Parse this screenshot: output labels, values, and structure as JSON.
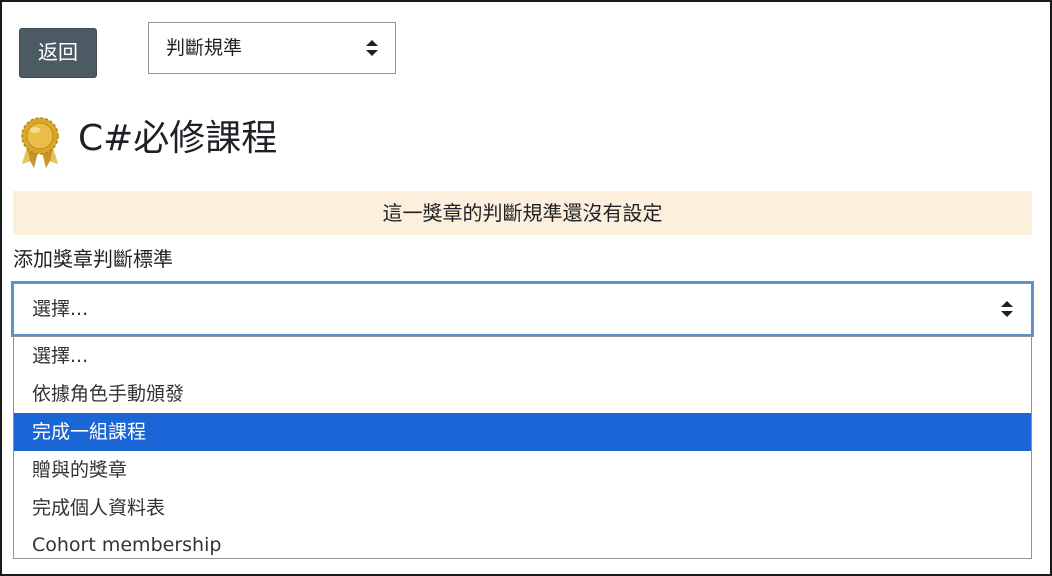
{
  "toolbar": {
    "back_label": "返回",
    "criteria_select_value": "判斷規準"
  },
  "badge": {
    "icon": "medal-icon",
    "title": "C#必修課程"
  },
  "notice": {
    "text": "這一獎章的判斷規準還沒有設定"
  },
  "add_criteria": {
    "label": "添加獎章判斷標準",
    "select_value": "選擇...",
    "options": [
      {
        "label": "選擇..."
      },
      {
        "label": "依據角色手動頒發"
      },
      {
        "label": "完成一組課程"
      },
      {
        "label": "贈與的獎章"
      },
      {
        "label": "完成個人資料表"
      },
      {
        "label": "Cohort membership"
      }
    ],
    "highlighted_option": "完成一組課程"
  },
  "colors": {
    "back_button_bg": "#4b5a63",
    "notice_bg": "#fcefdc",
    "highlight_bg": "#1a66d6",
    "focus_border": "#5b93c8",
    "medal_gold": "#d9a82b"
  }
}
